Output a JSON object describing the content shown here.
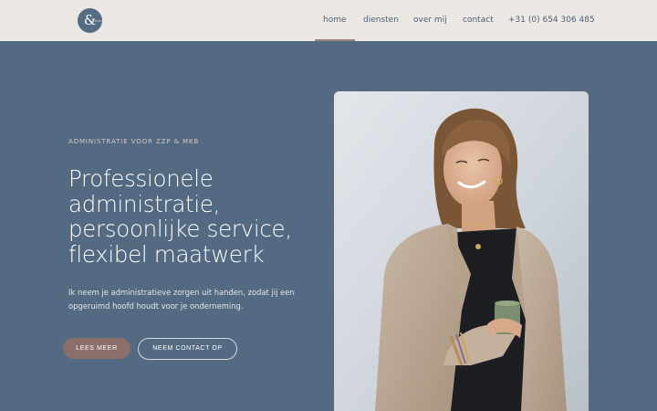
{
  "header": {
    "logo": {
      "glyph": "&",
      "small_text": "CONSULTING"
    },
    "nav": [
      {
        "label": "home",
        "active": true
      },
      {
        "label": "diensten",
        "active": false
      },
      {
        "label": "over mij",
        "active": false
      },
      {
        "label": "contact",
        "active": false
      }
    ],
    "phone": "+31 (0) 654 306 485"
  },
  "hero": {
    "eyebrow": "ADMINISTRATIE VOOR ZZP & MKB",
    "headline": [
      "Professionele",
      "administratie,",
      "persoonlijke service,",
      "flexibel maatwerk"
    ],
    "intro": "Ik neem je administratieve zorgen uit handen, zodat jij een opgeruimd hoofd houdt voor je onderneming.",
    "primary_button": "LEES MEER",
    "secondary_button": "NEEM CONTACT OP"
  },
  "photo": {
    "icon": "portrait-photo"
  },
  "colors": {
    "header_bg": "#ebe8e3",
    "hero_bg": "#536a82",
    "accent": "#8c6f6a",
    "logo_bg": "#566c84"
  }
}
